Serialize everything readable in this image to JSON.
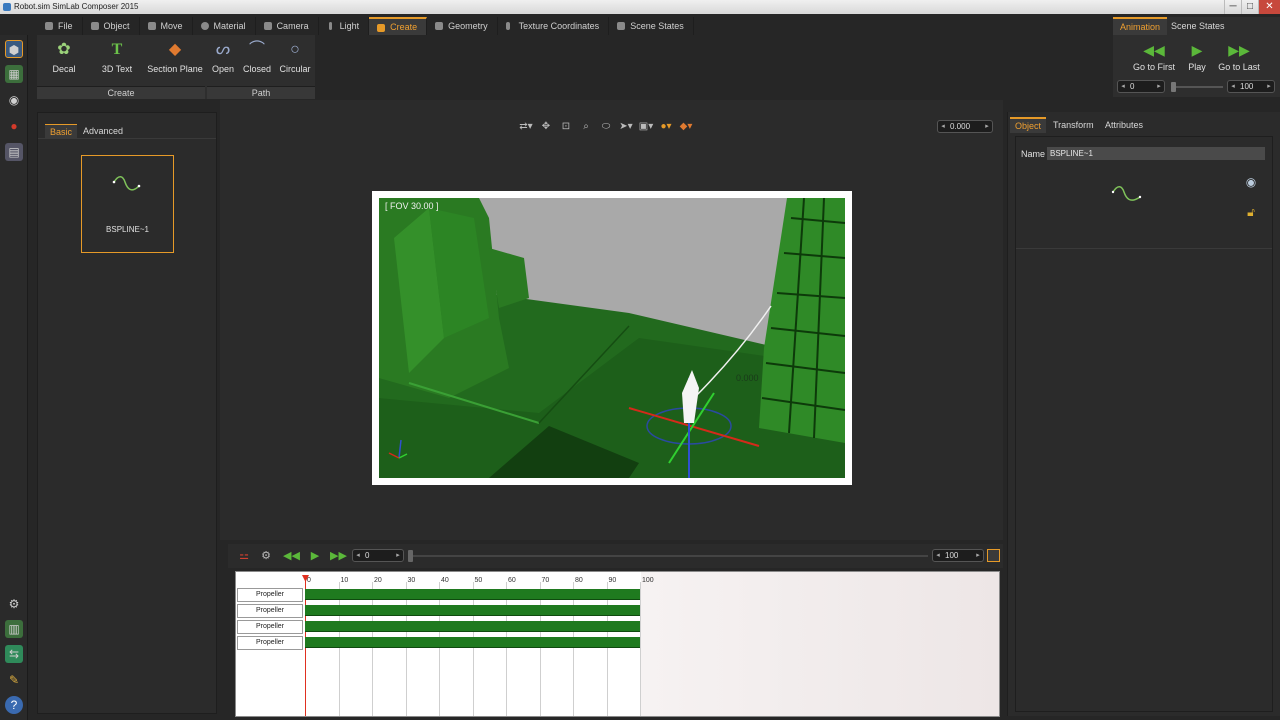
{
  "window": {
    "title": "Robot.sim SimLab Composer 2015",
    "controls": [
      "─",
      "□",
      "✕"
    ]
  },
  "menu": {
    "tabs": [
      "File",
      "Object",
      "Move",
      "Material",
      "Camera",
      "Light",
      "Create",
      "Geometry",
      "Texture Coordinates",
      "Scene States"
    ],
    "active": "Create"
  },
  "ribbon": {
    "create_group": {
      "label": "Create",
      "buttons": [
        "Decal",
        "3D Text",
        "Section Plane"
      ]
    },
    "path_group": {
      "label": "Path",
      "buttons": [
        "Open",
        "Closed",
        "Circular"
      ]
    }
  },
  "animation_panel": {
    "tabs": [
      "Animation",
      "Scene States"
    ],
    "active_tab": "Animation",
    "buttons": [
      "Go to First",
      "Play",
      "Go to Last"
    ],
    "start_value": "0",
    "end_value": "100"
  },
  "left_panel": {
    "tabs": [
      "Basic",
      "Advanced"
    ],
    "active_tab": "Basic",
    "selected_item": "BSPLINE~1"
  },
  "viewport": {
    "fov_label": "[ FOV 30.00 ]",
    "value_field": "0.000",
    "overlay_value": "0.000"
  },
  "right_panel": {
    "tabs": [
      "Object",
      "Transform",
      "Attributes"
    ],
    "active_tab": "Object",
    "name_label": "Name",
    "name_value": "BSPLINE~1"
  },
  "timeline": {
    "start_field": "0",
    "end_field": "100",
    "ticks": [
      "0",
      "10",
      "20",
      "30",
      "40",
      "50",
      "60",
      "70",
      "80",
      "90",
      "100"
    ],
    "tracks": [
      "Propeller",
      "Propeller",
      "Propeller",
      "Propeller"
    ],
    "track_color": "#1f7a1f"
  },
  "colors": {
    "accent": "#e69a28",
    "background": "#262626",
    "panel": "#2b2b2b",
    "play_green": "#5bb83a"
  }
}
